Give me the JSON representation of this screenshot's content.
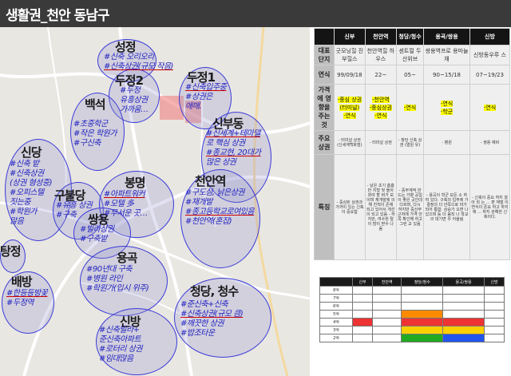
{
  "header": {
    "title": "생활권_천안 동남구"
  },
  "map": {
    "regions": [
      {
        "name": "성정",
        "notes": [
          "#신축 오리오리",
          "#신축상권(규모 작음)"
        ]
      },
      {
        "name": "두정2",
        "notes": [
          "#두정",
          "유흥상권",
          "가까움…"
        ]
      },
      {
        "name": "두정1",
        "notes": [
          "#신축입주중",
          "#상권은",
          "애매."
        ]
      },
      {
        "name": "백석",
        "notes": [
          "#초중학군",
          "#작은 학원가",
          "#구신축"
        ]
      },
      {
        "name": "신부동",
        "notes": [
          "#신세계+테마델",
          "로 핵심 상권",
          "#종교현, 20대가",
          "많은 상권"
        ]
      },
      {
        "name": "신당",
        "notes": [
          "#신축 밭",
          "#신축상권",
          "(상권 형성중)",
          "#오피스텔",
          "짓는중",
          "#학원가",
          "많음"
        ]
      },
      {
        "name": "구불당",
        "notes": [
          "#유흥 상권",
          "#구축"
        ]
      },
      {
        "name": "봉명",
        "notes": [
          "#아파트워커",
          "#모텔 多",
          "#무서운 곳…"
        ]
      },
      {
        "name": "천안역",
        "notes": [
          "#구도심, 낡은상권",
          "#재개발",
          "#종고등학교로여있음",
          "#천안역(혼잡)"
        ]
      },
      {
        "name": "쌍용",
        "notes": [
          "#빌라상권",
          "#구축밭"
        ]
      },
      {
        "name": "탕정",
        "notes": []
      },
      {
        "name": "용곡",
        "notes": [
          "#90년대 구축",
          "#병원 라인",
          "#학원가(입시 위주)"
        ]
      },
      {
        "name": "배방",
        "notes": [
          "#한등등방꽃",
          "#두정역"
        ]
      },
      {
        "name": "청당, 청수",
        "notes": [
          "#준신축+신축",
          "#신축상권(규모 큼)",
          "#깨끗한 상권",
          "#밥조타운"
        ]
      },
      {
        "name": "신방",
        "notes": [
          "#신축빌라+",
          "준신축아파트",
          "#로터리 상권",
          "#임대많음"
        ]
      }
    ]
  },
  "table": {
    "columns": [
      "",
      "신부",
      "천안역",
      "청당/청수",
      "용곡/쌍용",
      "신방"
    ],
    "rows": {
      "rep": {
        "label": "대표 단지",
        "cells": [
          "굿모닝힐 진부힐스",
          "천안역힐 하우스",
          "센트럴 두산위브",
          "쌍용역프로 용마늘채",
          "신방동우루 스"
        ]
      },
      "year": {
        "label": "연식",
        "cells": [
          "99/09/18",
          "22~",
          "05~",
          "90~15/18",
          "07~19/23"
        ]
      },
      "factor": {
        "label": "가격에 영향을 주는 것",
        "cells": [
          "-중심 상권(터미널)\n-연식",
          "-천안역\n-중심상권\n-연식",
          "-연식",
          "-연식\n-학군",
          "-연식"
        ]
      },
      "store": {
        "label": "주요 상권",
        "cells": [
          "- 터미널 상권 (신세계백화점)",
          "- 터미널 상권",
          "- 청당 신축 상권 (멀원 유)",
          "- 병원",
          "- 쌍용 예비"
        ]
      },
      "feature": {
        "label": "특징",
        "cells": [
          "- 중심된 상권과 가까이 있는 신축이 중요함",
          "- 낡은 초기 흠흠만 지형 및 돌아 와야 할 바가 보이며 재개발에 의해 친척이 존재 되고 있어서 개선이 되고 있음 - 하지만, 여수한 탈이 많이 받수 나옴",
          "- 중부계적 만드는 가향 공일이 좋은 곳인데 다르며, 다시 하지만 중산부 근처에 가격 안쪽 확인해 하고 그런 교 있음",
          "- 용곡이 학군 모든 소 하여 있다. 구축의 입주에 가 결정의 더 안쪽으로 마가되어 통함. 상승가 오면 나 있으며 등 더 움직 나 학교의 대기면 우 어울림",
          "- 신축이 중요 하지 않아 되 는 ... 편 재벌 이 연식이 존요 하고 하지 에 ... 하지 관해한 신축이다."
        ]
      }
    }
  },
  "gantt": {
    "columns": [
      "",
      "신부",
      "천안역",
      "청당/청수",
      "용곡/쌍용",
      "신방"
    ],
    "rows": [
      "8억",
      "7억",
      "6억",
      "5억",
      "4억",
      "3억",
      "2억"
    ]
  }
}
